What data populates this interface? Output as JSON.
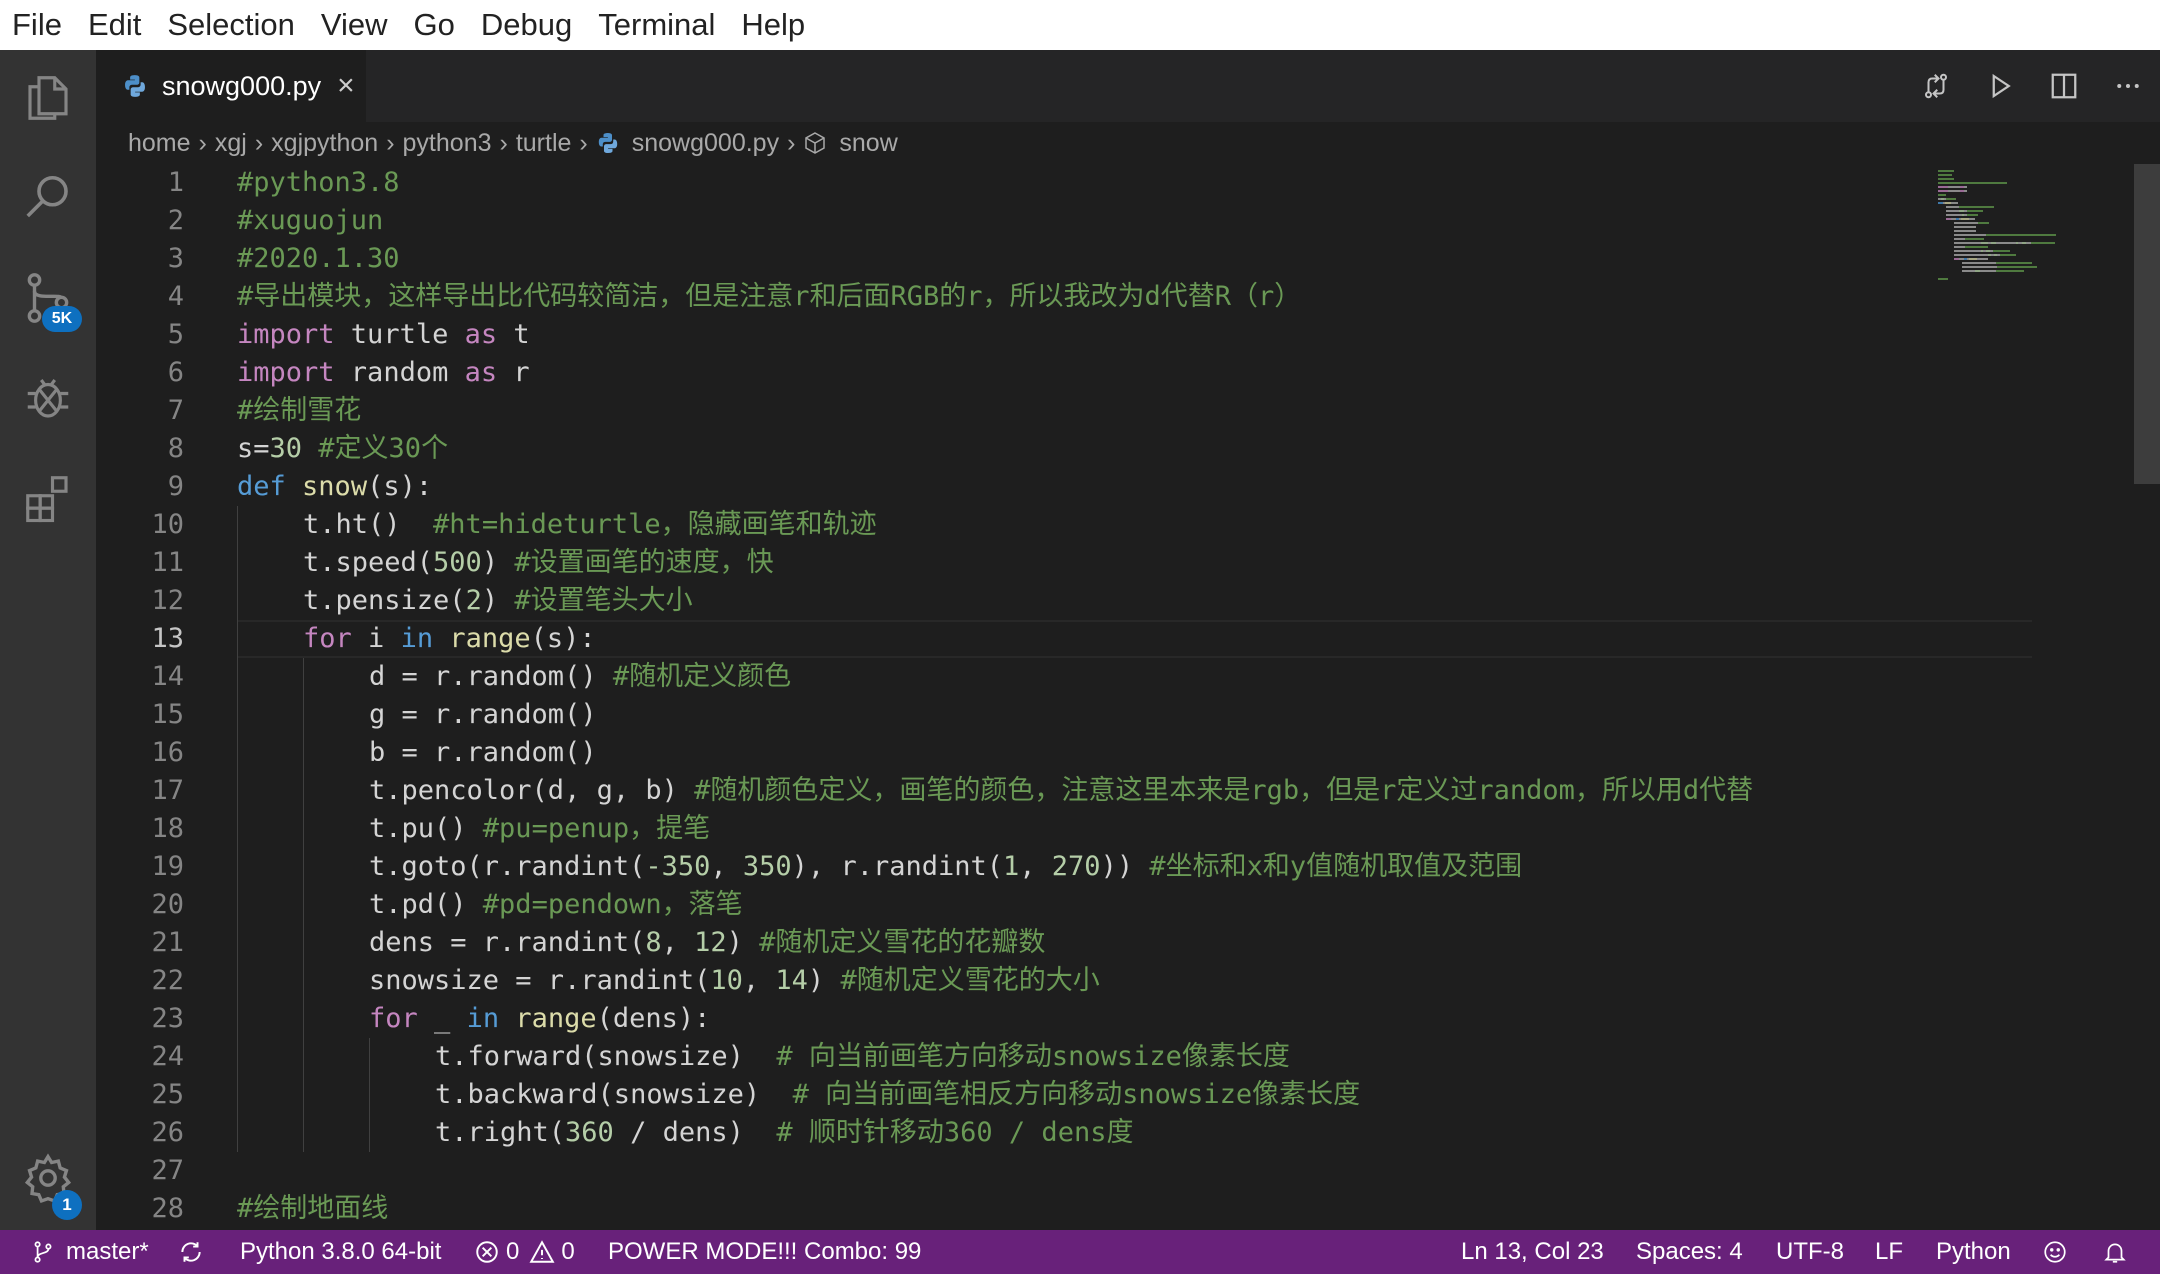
{
  "menu": [
    "File",
    "Edit",
    "Selection",
    "View",
    "Go",
    "Debug",
    "Terminal",
    "Help"
  ],
  "activity": {
    "scm_badge": "5K",
    "settings_badge": "1"
  },
  "tab": {
    "filename": "snowg000.py",
    "close": "×"
  },
  "breadcrumb": {
    "parts": [
      "home",
      "xgj",
      "xgjpython",
      "python3",
      "turtle"
    ],
    "file": "snowg000.py",
    "symbol": "snow",
    "sep": "›"
  },
  "editor": {
    "current_line": 13,
    "lines": [
      {
        "n": "1",
        "indent": 0,
        "tokens": [
          {
            "t": "#python3.8",
            "c": "com"
          }
        ]
      },
      {
        "n": "2",
        "indent": 0,
        "tokens": [
          {
            "t": "#xuguojun",
            "c": "com"
          }
        ]
      },
      {
        "n": "3",
        "indent": 0,
        "tokens": [
          {
            "t": "#2020.1.30",
            "c": "com"
          }
        ]
      },
      {
        "n": "4",
        "indent": 0,
        "tokens": [
          {
            "t": "#导出模块，这样导出比代码较简洁，但是注意r和后面RGB的r，所以我改为d代替R（r）",
            "c": "com"
          }
        ]
      },
      {
        "n": "5",
        "indent": 0,
        "tokens": [
          {
            "t": "import",
            "c": "kw"
          },
          {
            "t": " turtle ",
            "c": "plain"
          },
          {
            "t": "as",
            "c": "kw"
          },
          {
            "t": " t",
            "c": "plain"
          }
        ]
      },
      {
        "n": "6",
        "indent": 0,
        "tokens": [
          {
            "t": "import",
            "c": "kw"
          },
          {
            "t": " random ",
            "c": "plain"
          },
          {
            "t": "as",
            "c": "kw"
          },
          {
            "t": " r",
            "c": "plain"
          }
        ]
      },
      {
        "n": "7",
        "indent": 0,
        "tokens": [
          {
            "t": "#绘制雪花",
            "c": "com"
          }
        ]
      },
      {
        "n": "8",
        "indent": 0,
        "tokens": [
          {
            "t": "s=",
            "c": "plain"
          },
          {
            "t": "30",
            "c": "num"
          },
          {
            "t": " ",
            "c": "plain"
          },
          {
            "t": "#定义30个",
            "c": "com"
          }
        ]
      },
      {
        "n": "9",
        "indent": 0,
        "tokens": [
          {
            "t": "def",
            "c": "def"
          },
          {
            "t": " ",
            "c": "plain"
          },
          {
            "t": "snow",
            "c": "fn"
          },
          {
            "t": "(s):",
            "c": "plain"
          }
        ]
      },
      {
        "n": "10",
        "indent": 1,
        "tokens": [
          {
            "t": "t.ht()  ",
            "c": "plain"
          },
          {
            "t": "#ht=hideturtle，隐藏画笔和轨迹",
            "c": "com"
          }
        ]
      },
      {
        "n": "11",
        "indent": 1,
        "tokens": [
          {
            "t": "t.speed(",
            "c": "plain"
          },
          {
            "t": "500",
            "c": "num"
          },
          {
            "t": ") ",
            "c": "plain"
          },
          {
            "t": "#设置画笔的速度，快",
            "c": "com"
          }
        ]
      },
      {
        "n": "12",
        "indent": 1,
        "tokens": [
          {
            "t": "t.pensize(",
            "c": "plain"
          },
          {
            "t": "2",
            "c": "num"
          },
          {
            "t": ") ",
            "c": "plain"
          },
          {
            "t": "#设置笔头大小",
            "c": "com"
          }
        ]
      },
      {
        "n": "13",
        "indent": 1,
        "tokens": [
          {
            "t": "for",
            "c": "kw"
          },
          {
            "t": " i ",
            "c": "plain"
          },
          {
            "t": "in",
            "c": "def"
          },
          {
            "t": " ",
            "c": "plain"
          },
          {
            "t": "range",
            "c": "fn"
          },
          {
            "t": "(s):",
            "c": "plain"
          }
        ]
      },
      {
        "n": "14",
        "indent": 2,
        "tokens": [
          {
            "t": "d = r.random() ",
            "c": "plain"
          },
          {
            "t": "#随机定义颜色",
            "c": "com"
          }
        ]
      },
      {
        "n": "15",
        "indent": 2,
        "tokens": [
          {
            "t": "g = r.random()",
            "c": "plain"
          }
        ]
      },
      {
        "n": "16",
        "indent": 2,
        "tokens": [
          {
            "t": "b = r.random()",
            "c": "plain"
          }
        ]
      },
      {
        "n": "17",
        "indent": 2,
        "tokens": [
          {
            "t": "t.pencolor(d, g, b) ",
            "c": "plain"
          },
          {
            "t": "#随机颜色定义，画笔的颜色，注意这里本来是rgb，但是r定义过random，所以用d代替",
            "c": "com"
          }
        ]
      },
      {
        "n": "18",
        "indent": 2,
        "tokens": [
          {
            "t": "t.pu() ",
            "c": "plain"
          },
          {
            "t": "#pu=penup，提笔",
            "c": "com"
          }
        ]
      },
      {
        "n": "19",
        "indent": 2,
        "tokens": [
          {
            "t": "t.goto(r.randint(",
            "c": "plain"
          },
          {
            "t": "-350",
            "c": "num"
          },
          {
            "t": ", ",
            "c": "plain"
          },
          {
            "t": "350",
            "c": "num"
          },
          {
            "t": "), r.randint(",
            "c": "plain"
          },
          {
            "t": "1",
            "c": "num"
          },
          {
            "t": ", ",
            "c": "plain"
          },
          {
            "t": "270",
            "c": "num"
          },
          {
            "t": ")) ",
            "c": "plain"
          },
          {
            "t": "#坐标和x和y值随机取值及范围",
            "c": "com"
          }
        ]
      },
      {
        "n": "20",
        "indent": 2,
        "tokens": [
          {
            "t": "t.pd() ",
            "c": "plain"
          },
          {
            "t": "#pd=pendown，落笔",
            "c": "com"
          }
        ]
      },
      {
        "n": "21",
        "indent": 2,
        "tokens": [
          {
            "t": "dens = r.randint(",
            "c": "plain"
          },
          {
            "t": "8",
            "c": "num"
          },
          {
            "t": ", ",
            "c": "plain"
          },
          {
            "t": "12",
            "c": "num"
          },
          {
            "t": ") ",
            "c": "plain"
          },
          {
            "t": "#随机定义雪花的花瓣数",
            "c": "com"
          }
        ]
      },
      {
        "n": "22",
        "indent": 2,
        "tokens": [
          {
            "t": "snowsize = r.randint(",
            "c": "plain"
          },
          {
            "t": "10",
            "c": "num"
          },
          {
            "t": ", ",
            "c": "plain"
          },
          {
            "t": "14",
            "c": "num"
          },
          {
            "t": ") ",
            "c": "plain"
          },
          {
            "t": "#随机定义雪花的大小",
            "c": "com"
          }
        ]
      },
      {
        "n": "23",
        "indent": 2,
        "tokens": [
          {
            "t": "for",
            "c": "kw"
          },
          {
            "t": " _ ",
            "c": "plain"
          },
          {
            "t": "in",
            "c": "def"
          },
          {
            "t": " ",
            "c": "plain"
          },
          {
            "t": "range",
            "c": "fn"
          },
          {
            "t": "(dens):",
            "c": "plain"
          }
        ]
      },
      {
        "n": "24",
        "indent": 3,
        "tokens": [
          {
            "t": "t.forward(snowsize)  ",
            "c": "plain"
          },
          {
            "t": "# 向当前画笔方向移动snowsize像素长度",
            "c": "com"
          }
        ]
      },
      {
        "n": "25",
        "indent": 3,
        "tokens": [
          {
            "t": "t.backward(snowsize)  ",
            "c": "plain"
          },
          {
            "t": "# 向当前画笔相反方向移动snowsize像素长度",
            "c": "com"
          }
        ]
      },
      {
        "n": "26",
        "indent": 3,
        "tokens": [
          {
            "t": "t.right(",
            "c": "plain"
          },
          {
            "t": "360",
            "c": "num"
          },
          {
            "t": " / dens)  ",
            "c": "plain"
          },
          {
            "t": "# 顺时针移动360 / dens度",
            "c": "com"
          }
        ]
      },
      {
        "n": "27",
        "indent": 0,
        "tokens": []
      },
      {
        "n": "28",
        "indent": 0,
        "tokens": [
          {
            "t": "#绘制地面线",
            "c": "com"
          }
        ]
      }
    ]
  },
  "status": {
    "branch": "master*",
    "interpreter": "Python 3.8.0 64-bit",
    "errors": "0",
    "warnings": "0",
    "power_mode": "POWER MODE!!! Combo: 99",
    "position": "Ln 13, Col 23",
    "spaces": "Spaces: 4",
    "encoding": "UTF-8",
    "eol": "LF",
    "language": "Python"
  },
  "colors": {
    "statusbar": "#68217a",
    "badge": "#0e70c0",
    "editor_bg": "#1e1e1e",
    "comment": "#6a9955",
    "keyword": "#c586c0"
  }
}
